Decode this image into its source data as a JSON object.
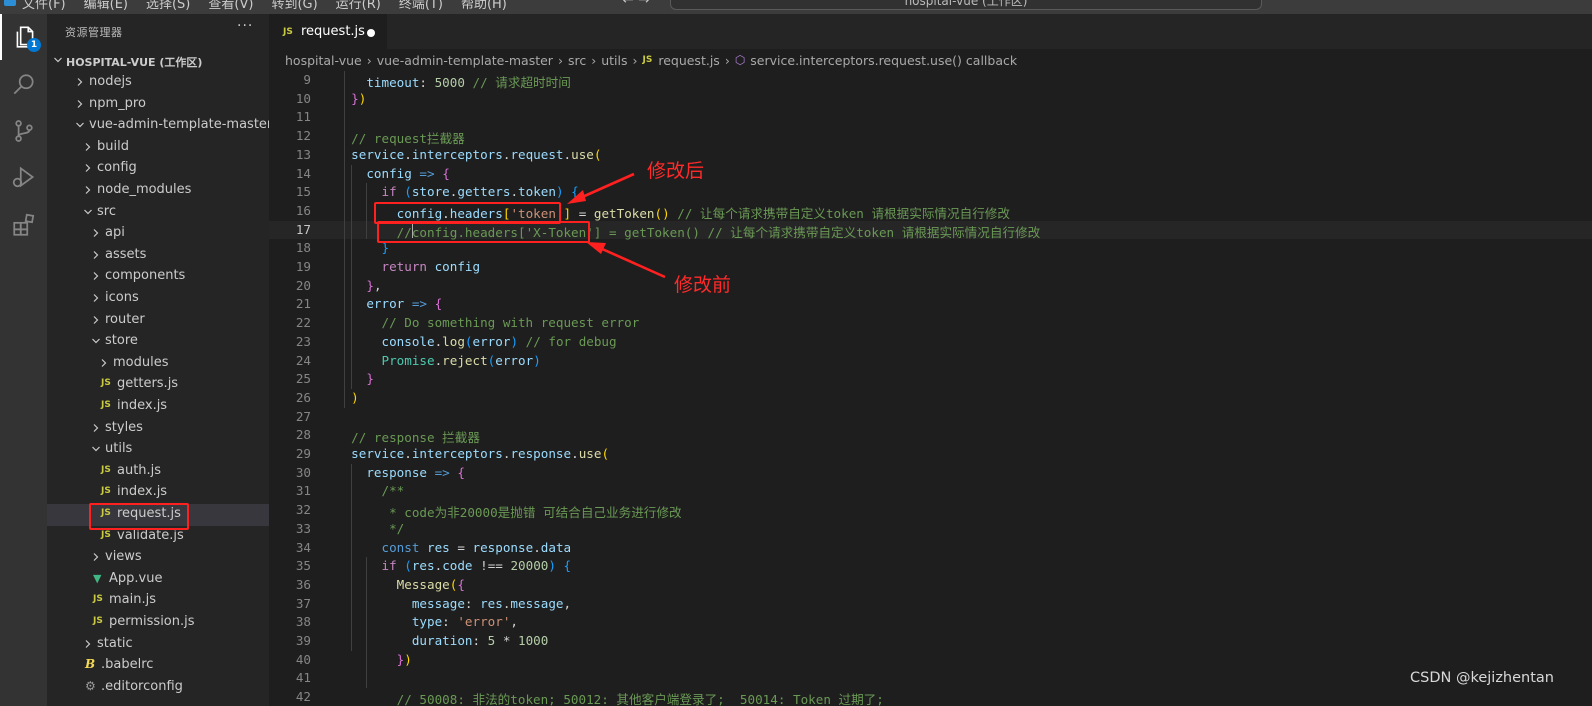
{
  "titlebar": {
    "menu": [
      "文件(F)",
      "编辑(E)",
      "选择(S)",
      "查看(V)",
      "转到(G)",
      "运行(R)",
      "终端(T)",
      "帮助(H)"
    ],
    "command_center": "hospital-vue (工作区)",
    "nav_arrows": "←  →"
  },
  "activitybar": {
    "items": [
      "explorer-icon",
      "search-icon",
      "source-control-icon",
      "run-debug-icon",
      "extensions-icon"
    ],
    "explorer_badge": "1"
  },
  "sidebar": {
    "title": "资源管理器",
    "more": "···",
    "workspace": "HOSPITAL-VUE (工作区)",
    "tree": [
      {
        "label": "nodejs",
        "type": "folder",
        "open": false,
        "depth": 0
      },
      {
        "label": "npm_pro",
        "type": "folder",
        "open": false,
        "depth": 0
      },
      {
        "label": "vue-admin-template-master",
        "type": "folder",
        "open": true,
        "depth": 0
      },
      {
        "label": "build",
        "type": "folder",
        "open": false,
        "depth": 1
      },
      {
        "label": "config",
        "type": "folder",
        "open": false,
        "depth": 1
      },
      {
        "label": "node_modules",
        "type": "folder",
        "open": false,
        "depth": 1
      },
      {
        "label": "src",
        "type": "folder",
        "open": true,
        "depth": 1
      },
      {
        "label": "api",
        "type": "folder",
        "open": false,
        "depth": 2
      },
      {
        "label": "assets",
        "type": "folder",
        "open": false,
        "depth": 2
      },
      {
        "label": "components",
        "type": "folder",
        "open": false,
        "depth": 2
      },
      {
        "label": "icons",
        "type": "folder",
        "open": false,
        "depth": 2
      },
      {
        "label": "router",
        "type": "folder",
        "open": false,
        "depth": 2
      },
      {
        "label": "store",
        "type": "folder",
        "open": true,
        "depth": 2
      },
      {
        "label": "modules",
        "type": "folder",
        "open": false,
        "depth": 3
      },
      {
        "label": "getters.js",
        "type": "js",
        "depth": 3
      },
      {
        "label": "index.js",
        "type": "js",
        "depth": 3
      },
      {
        "label": "styles",
        "type": "folder",
        "open": false,
        "depth": 2
      },
      {
        "label": "utils",
        "type": "folder",
        "open": true,
        "depth": 2
      },
      {
        "label": "auth.js",
        "type": "js",
        "depth": 3
      },
      {
        "label": "index.js",
        "type": "js",
        "depth": 3
      },
      {
        "label": "request.js",
        "type": "js",
        "depth": 3,
        "selected": true
      },
      {
        "label": "validate.js",
        "type": "js",
        "depth": 3
      },
      {
        "label": "views",
        "type": "folder",
        "open": false,
        "depth": 2
      },
      {
        "label": "App.vue",
        "type": "vue",
        "depth": 2
      },
      {
        "label": "main.js",
        "type": "js",
        "depth": 2
      },
      {
        "label": "permission.js",
        "type": "js",
        "depth": 2
      },
      {
        "label": "static",
        "type": "folder",
        "open": false,
        "depth": 1
      },
      {
        "label": ".babelrc",
        "type": "babel",
        "depth": 1
      },
      {
        "label": ".editorconfig",
        "type": "gear",
        "depth": 1
      }
    ]
  },
  "editor": {
    "tab": {
      "icon": "JS",
      "label": "request.js",
      "modified": true
    },
    "breadcrumb": [
      "hospital-vue",
      "vue-admin-template-master",
      "src",
      "utils",
      "request.js",
      "service.interceptors.request.use() callback"
    ],
    "js_icon_text": "JS",
    "current_line": 17,
    "lines": [
      {
        "n": "9",
        "tokens": [
          [
            "    ",
            ""
          ],
          [
            "timeout",
            "t-var"
          ],
          [
            ": ",
            "t-op"
          ],
          [
            "5000",
            "t-num"
          ],
          [
            " // 请求超时时间",
            "t-com"
          ]
        ]
      },
      {
        "n": "10",
        "tokens": [
          [
            "  ",
            ""
          ],
          [
            "}",
            "t-p2"
          ],
          [
            ")",
            "t-p1"
          ]
        ]
      },
      {
        "n": "11",
        "tokens": []
      },
      {
        "n": "12",
        "tokens": [
          [
            "  ",
            ""
          ],
          [
            "// request拦截器",
            "t-com"
          ]
        ]
      },
      {
        "n": "13",
        "tokens": [
          [
            "  ",
            ""
          ],
          [
            "service",
            "t-var"
          ],
          [
            ".",
            "t-op"
          ],
          [
            "interceptors",
            "t-var"
          ],
          [
            ".",
            "t-op"
          ],
          [
            "request",
            "t-var"
          ],
          [
            ".",
            "t-op"
          ],
          [
            "use",
            "t-fn"
          ],
          [
            "(",
            "t-p1"
          ]
        ]
      },
      {
        "n": "14",
        "tokens": [
          [
            "    ",
            ""
          ],
          [
            "config",
            "t-var"
          ],
          [
            " => ",
            "t-kw"
          ],
          [
            "{",
            "t-p2"
          ]
        ]
      },
      {
        "n": "15",
        "tokens": [
          [
            "      ",
            ""
          ],
          [
            "if",
            "t-kw2"
          ],
          [
            " (",
            "t-p3"
          ],
          [
            "store",
            "t-var"
          ],
          [
            ".",
            "t-op"
          ],
          [
            "getters",
            "t-var"
          ],
          [
            ".",
            "t-op"
          ],
          [
            "token",
            "t-var"
          ],
          [
            ") ",
            "t-p3"
          ],
          [
            "{",
            "t-p3"
          ]
        ]
      },
      {
        "n": "16",
        "tokens": [
          [
            "        ",
            ""
          ],
          [
            "config",
            "t-var"
          ],
          [
            ".",
            "t-op"
          ],
          [
            "headers",
            "t-var"
          ],
          [
            "[",
            "t-p1"
          ],
          [
            "'token'",
            "t-str"
          ],
          [
            "]",
            "t-p1"
          ],
          [
            " = ",
            "t-op"
          ],
          [
            "getToken",
            "t-fn"
          ],
          [
            "()",
            "t-p1"
          ],
          [
            " // 让每个请求携带自定义token 请根据实际情况自行修改",
            "t-com"
          ]
        ]
      },
      {
        "n": "17",
        "tokens": [
          [
            "        ",
            ""
          ],
          [
            "//config.headers['X-Token'] = getToken() // 让每个请求携带自定义token 请根据实际情况自行修改",
            "t-com"
          ]
        ]
      },
      {
        "n": "18",
        "tokens": [
          [
            "      ",
            ""
          ],
          [
            "}",
            "t-p3"
          ]
        ]
      },
      {
        "n": "19",
        "tokens": [
          [
            "      ",
            ""
          ],
          [
            "return",
            "t-kw2"
          ],
          [
            " config",
            "t-var"
          ]
        ]
      },
      {
        "n": "20",
        "tokens": [
          [
            "    ",
            ""
          ],
          [
            "}",
            "t-p2"
          ],
          [
            ",",
            "t-op"
          ]
        ]
      },
      {
        "n": "21",
        "tokens": [
          [
            "    ",
            ""
          ],
          [
            "error",
            "t-var"
          ],
          [
            " => ",
            "t-kw"
          ],
          [
            "{",
            "t-p2"
          ]
        ]
      },
      {
        "n": "22",
        "tokens": [
          [
            "      ",
            ""
          ],
          [
            "// Do something with request error",
            "t-com"
          ]
        ]
      },
      {
        "n": "23",
        "tokens": [
          [
            "      ",
            ""
          ],
          [
            "console",
            "t-var"
          ],
          [
            ".",
            "t-op"
          ],
          [
            "log",
            "t-fn"
          ],
          [
            "(",
            "t-p3"
          ],
          [
            "error",
            "t-var"
          ],
          [
            ")",
            "t-p3"
          ],
          [
            " // for debug",
            "t-com"
          ]
        ]
      },
      {
        "n": "24",
        "tokens": [
          [
            "      ",
            ""
          ],
          [
            "Promise",
            "t-cls"
          ],
          [
            ".",
            "t-op"
          ],
          [
            "reject",
            "t-fn"
          ],
          [
            "(",
            "t-p3"
          ],
          [
            "error",
            "t-var"
          ],
          [
            ")",
            "t-p3"
          ]
        ]
      },
      {
        "n": "25",
        "tokens": [
          [
            "    ",
            ""
          ],
          [
            "}",
            "t-p2"
          ]
        ]
      },
      {
        "n": "26",
        "tokens": [
          [
            "  ",
            ""
          ],
          [
            ")",
            "t-p1"
          ]
        ]
      },
      {
        "n": "27",
        "tokens": []
      },
      {
        "n": "28",
        "tokens": [
          [
            "  ",
            ""
          ],
          [
            "// response 拦截器",
            "t-com"
          ]
        ]
      },
      {
        "n": "29",
        "tokens": [
          [
            "  ",
            ""
          ],
          [
            "service",
            "t-var"
          ],
          [
            ".",
            "t-op"
          ],
          [
            "interceptors",
            "t-var"
          ],
          [
            ".",
            "t-op"
          ],
          [
            "response",
            "t-var"
          ],
          [
            ".",
            "t-op"
          ],
          [
            "use",
            "t-fn"
          ],
          [
            "(",
            "t-p1"
          ]
        ]
      },
      {
        "n": "30",
        "tokens": [
          [
            "    ",
            ""
          ],
          [
            "response",
            "t-var"
          ],
          [
            " => ",
            "t-kw"
          ],
          [
            "{",
            "t-p2"
          ]
        ]
      },
      {
        "n": "31",
        "tokens": [
          [
            "      ",
            ""
          ],
          [
            "/**",
            "t-com"
          ]
        ]
      },
      {
        "n": "32",
        "tokens": [
          [
            "       ",
            ""
          ],
          [
            "* code为非20000是抛错 可结合自己业务进行修改",
            "t-com"
          ]
        ]
      },
      {
        "n": "33",
        "tokens": [
          [
            "       ",
            ""
          ],
          [
            "*/",
            "t-com"
          ]
        ]
      },
      {
        "n": "34",
        "tokens": [
          [
            "      ",
            ""
          ],
          [
            "const",
            "t-kw"
          ],
          [
            " res",
            "t-var"
          ],
          [
            " = ",
            "t-op"
          ],
          [
            "response",
            "t-var"
          ],
          [
            ".",
            "t-op"
          ],
          [
            "data",
            "t-var"
          ]
        ]
      },
      {
        "n": "35",
        "tokens": [
          [
            "      ",
            ""
          ],
          [
            "if",
            "t-kw2"
          ],
          [
            " (",
            "t-p3"
          ],
          [
            "res",
            "t-var"
          ],
          [
            ".",
            "t-op"
          ],
          [
            "code",
            "t-var"
          ],
          [
            " !== ",
            "t-op"
          ],
          [
            "20000",
            "t-num"
          ],
          [
            ") ",
            "t-p3"
          ],
          [
            "{",
            "t-p3"
          ]
        ]
      },
      {
        "n": "36",
        "tokens": [
          [
            "        ",
            ""
          ],
          [
            "Message",
            "t-fn"
          ],
          [
            "(",
            "t-p1"
          ],
          [
            "{",
            "t-p2"
          ]
        ]
      },
      {
        "n": "37",
        "tokens": [
          [
            "          ",
            ""
          ],
          [
            "message",
            "t-var"
          ],
          [
            ": ",
            "t-op"
          ],
          [
            "res",
            "t-var"
          ],
          [
            ".",
            "t-op"
          ],
          [
            "message",
            "t-var"
          ],
          [
            ",",
            "t-op"
          ]
        ]
      },
      {
        "n": "38",
        "tokens": [
          [
            "          ",
            ""
          ],
          [
            "type",
            "t-var"
          ],
          [
            ": ",
            "t-op"
          ],
          [
            "'error'",
            "t-str"
          ],
          [
            ",",
            "t-op"
          ]
        ]
      },
      {
        "n": "39",
        "tokens": [
          [
            "          ",
            ""
          ],
          [
            "duration",
            "t-var"
          ],
          [
            ": ",
            "t-op"
          ],
          [
            "5",
            "t-num"
          ],
          [
            " * ",
            "t-op"
          ],
          [
            "1000",
            "t-num"
          ]
        ]
      },
      {
        "n": "40",
        "tokens": [
          [
            "        ",
            ""
          ],
          [
            "}",
            "t-p2"
          ],
          [
            ")",
            "t-p1"
          ]
        ]
      },
      {
        "n": "41",
        "tokens": []
      },
      {
        "n": "42",
        "tokens": [
          [
            "        ",
            ""
          ],
          [
            "// 50008: 非法的token; 50012: 其他客户端登录了;  50014: Token 过期了;",
            "t-com"
          ]
        ]
      }
    ]
  },
  "annotations": {
    "after_label": "修改后",
    "before_label": "修改前",
    "color": "#ff2020"
  },
  "watermark": "CSDN @kejizhentan"
}
